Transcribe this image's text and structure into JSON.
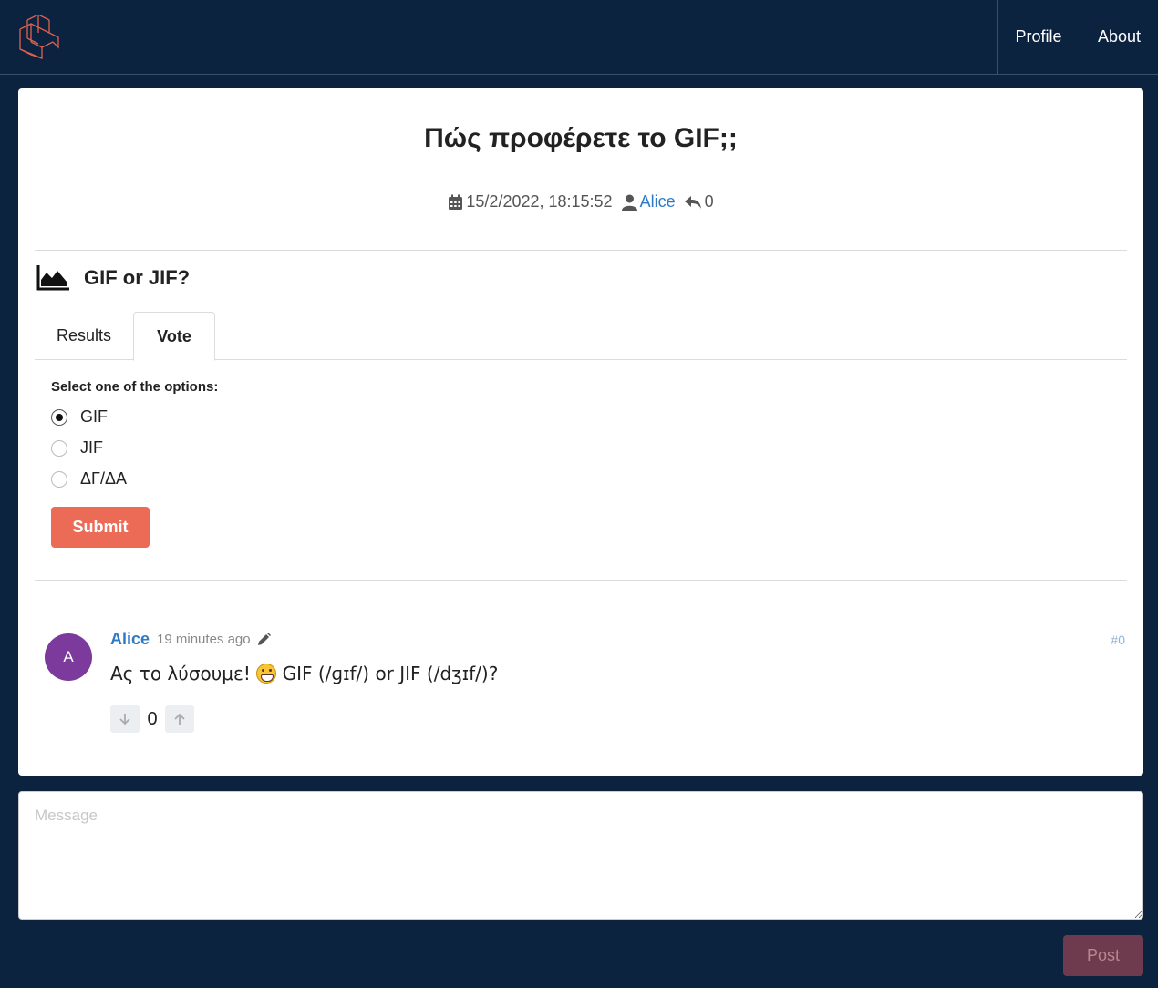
{
  "nav": {
    "logo_icon": "site-logo-icon",
    "profile_label": "Profile",
    "about_label": "About"
  },
  "thread": {
    "title": "Πώς προφέρετε το GIF;;",
    "date": "15/2/2022, 18:15:52",
    "author": "Alice",
    "reply_count": "0"
  },
  "poll": {
    "icon": "area-chart-icon",
    "title": "GIF or JIF?",
    "tabs": [
      {
        "label": "Results",
        "active": false
      },
      {
        "label": "Vote",
        "active": true
      }
    ],
    "select_label": "Select one of the options:",
    "options": [
      {
        "label": "GIF",
        "checked": true
      },
      {
        "label": "JIF",
        "checked": false
      },
      {
        "label": "ΔΓ/ΔΑ",
        "checked": false
      }
    ],
    "submit_label": "Submit"
  },
  "comment": {
    "avatar_letter": "A",
    "author": "Alice",
    "time": "19 minutes ago",
    "number": "#0",
    "body_before_emoji": "Ας το λύσουμε! ",
    "body_after_emoji": " GIF (/ɡɪf/) or JIF (/dʒɪf/)?",
    "votes": "0"
  },
  "composer": {
    "placeholder": "Message",
    "post_label": "Post"
  },
  "colors": {
    "background": "#0c2340",
    "accent": "#ec6b57",
    "link": "#2e7bc4",
    "avatar": "#7b3a9c"
  }
}
